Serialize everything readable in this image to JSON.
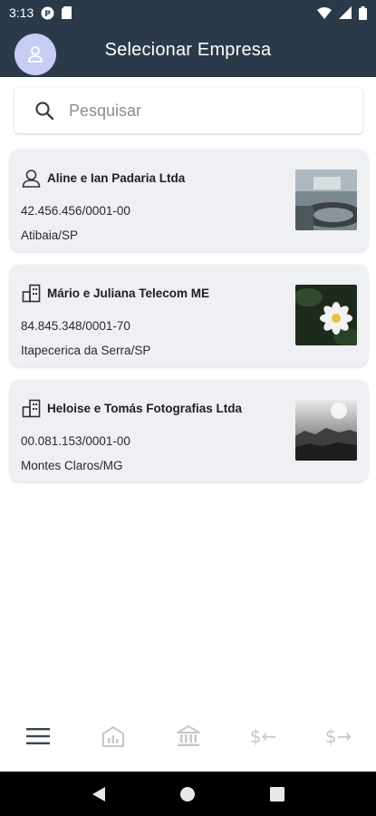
{
  "status_bar": {
    "time": "3:13"
  },
  "header": {
    "title": "Selecionar Empresa"
  },
  "search": {
    "placeholder": "Pesquisar",
    "value": ""
  },
  "companies": [
    {
      "name": "Aline e Ian Padaria Ltda",
      "document": "42.456.456/0001-00",
      "city": "Atibaia/SP",
      "icon": "person-icon"
    },
    {
      "name": "Mário e Juliana Telecom ME",
      "document": "84.845.348/0001-70",
      "city": "Itapecerica da Serra/SP",
      "icon": "building-icon"
    },
    {
      "name": "Heloise e Tomás Fotografias Ltda",
      "document": "00.081.153/0001-00",
      "city": "Montes Claros/MG",
      "icon": "building-icon"
    }
  ],
  "bottom_nav": {
    "items": [
      "menu-icon",
      "dashboard-icon",
      "bank-icon",
      "money-in-icon",
      "money-out-icon"
    ],
    "money_in_label": "$←",
    "money_out_label": "$→"
  },
  "colors": {
    "header_bg": "#2b3a49",
    "card_bg": "#eef0f4",
    "avatar_bg": "#c8cdf5",
    "nav_active": "#37474f",
    "nav_inactive": "#c4c8cc"
  }
}
